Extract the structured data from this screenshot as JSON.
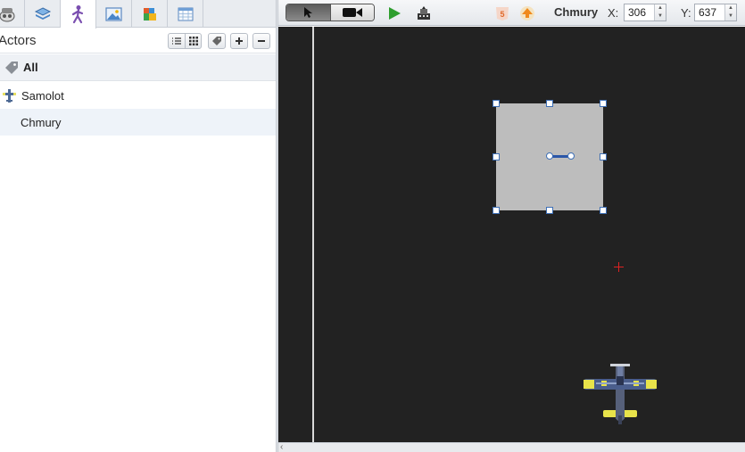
{
  "left_panel": {
    "tabs": [
      {
        "icon": "scene-icon",
        "active": false
      },
      {
        "icon": "layers-icon",
        "active": false
      },
      {
        "icon": "actors-icon",
        "active": true
      },
      {
        "icon": "image-icon",
        "active": false
      },
      {
        "icon": "tiles-icon",
        "active": false
      },
      {
        "icon": "table-icon",
        "active": false
      }
    ],
    "header": {
      "title": "Actors",
      "buttons": [
        "list-view-icon",
        "grid-view-icon",
        "tag-icon",
        "add-icon",
        "remove-icon"
      ]
    },
    "rows": [
      {
        "label": "All",
        "icon": "tag-icon",
        "bold": true
      },
      {
        "label": "Samolot",
        "icon": "plane-icon",
        "bold": false
      },
      {
        "label": "Chmury",
        "icon": "",
        "bold": false
      }
    ]
  },
  "toolbar": {
    "mode_tools": [
      "pointer-icon",
      "camera-icon"
    ],
    "active_mode": "pointer",
    "buttons": [
      "play-icon",
      "export-icon",
      "html5-icon",
      "upload-icon"
    ],
    "selected_name": "Chmury",
    "x_label": "X:",
    "x_value": "306",
    "y_label": "Y:",
    "y_value": "637"
  },
  "canvas": {
    "background": "#222222",
    "selected_fill": "#bdbdbd",
    "handle_color": "#3d6fb6",
    "crosshair_color": "#dd2222"
  },
  "colors": {
    "panel_bg": "#ffffff",
    "toolbar_bg": "#e4e7eb",
    "active_tab_bg": "#ffffff",
    "play_green": "#2e9e2e",
    "actor_icon_purple": "#7b4fb0"
  }
}
